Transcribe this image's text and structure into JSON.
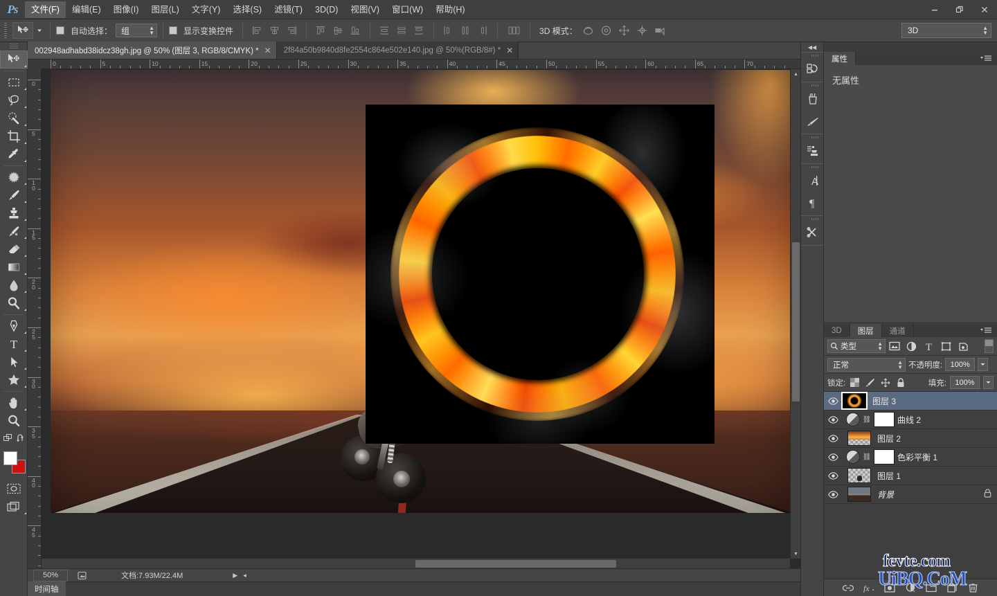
{
  "app": {
    "logo": "Ps",
    "theme_bg": "#3c3c3c",
    "accent": "#5a6a80"
  },
  "menubar": {
    "items": [
      {
        "label": "文件(F)",
        "active": true
      },
      {
        "label": "编辑(E)",
        "active": false
      },
      {
        "label": "图像(I)",
        "active": false
      },
      {
        "label": "图层(L)",
        "active": false
      },
      {
        "label": "文字(Y)",
        "active": false
      },
      {
        "label": "选择(S)",
        "active": false
      },
      {
        "label": "滤镜(T)",
        "active": false
      },
      {
        "label": "3D(D)",
        "active": false
      },
      {
        "label": "视图(V)",
        "active": false
      },
      {
        "label": "窗口(W)",
        "active": false
      },
      {
        "label": "帮助(H)",
        "active": false
      }
    ],
    "window_controls": {
      "minimize": "—",
      "restore": "❐",
      "close": "✕"
    }
  },
  "options_bar": {
    "tool_icon": "move-tool-icon",
    "auto_select_label": "自动选择：",
    "auto_select_value": "组",
    "auto_select_checked": false,
    "show_transform_label": "显示变换控件",
    "show_transform_checked": false,
    "mode_3d_label": "3D 模式：",
    "workspace": "3D"
  },
  "toolbox": {
    "tools": [
      {
        "name": "move-tool",
        "selected": true
      },
      {
        "name": "rectangular-marquee-tool",
        "selected": false
      },
      {
        "name": "lasso-tool",
        "selected": false
      },
      {
        "name": "quick-selection-tool",
        "selected": false
      },
      {
        "name": "crop-tool",
        "selected": false
      },
      {
        "name": "eyedropper-tool",
        "selected": false
      },
      {
        "name": "spot-healing-brush-tool",
        "selected": false
      },
      {
        "name": "brush-tool",
        "selected": false
      },
      {
        "name": "clone-stamp-tool",
        "selected": false
      },
      {
        "name": "history-brush-tool",
        "selected": false
      },
      {
        "name": "eraser-tool",
        "selected": false
      },
      {
        "name": "gradient-tool",
        "selected": false
      },
      {
        "name": "blur-tool",
        "selected": false
      },
      {
        "name": "dodge-tool",
        "selected": false
      },
      {
        "name": "pen-tool",
        "selected": false
      },
      {
        "name": "horizontal-type-tool",
        "selected": false
      },
      {
        "name": "path-selection-tool",
        "selected": false
      },
      {
        "name": "custom-shape-tool",
        "selected": false
      },
      {
        "name": "hand-tool",
        "selected": false
      },
      {
        "name": "zoom-tool",
        "selected": false
      }
    ],
    "foreground_color": "#ffffff",
    "background_color": "#cc1111"
  },
  "document_tabs": [
    {
      "label": "002948adhabd38idcz38gh.jpg @ 50% (图层 3, RGB/8/CMYK) *",
      "close": "✕",
      "active": true
    },
    {
      "label": "2f84a50b9840d8fe2554c864e502e140.jpg @ 50%(RGB/8#) *",
      "close": "✕",
      "active": false
    }
  ],
  "rulers": {
    "horizontal_ticks": [
      "0",
      "5",
      "10",
      "15",
      "20",
      "25",
      "30",
      "35",
      "40",
      "45",
      "50",
      "55",
      "60",
      "65",
      "70"
    ],
    "vertical_ticks": [
      "0",
      "5",
      "10",
      "15",
      "20",
      "25",
      "30",
      "35",
      "40",
      "45"
    ],
    "unit_step": 5
  },
  "canvas": {
    "artwork_description": "sunset sky over desert road with motorcycle, fire ring image placed on top",
    "placed_image": "fire-ring-on-black"
  },
  "status_bar": {
    "zoom": "50%",
    "doc_label": "文档:7.93M/22.4M",
    "play_arrow": "▶",
    "left_arrow": "◂"
  },
  "timeline": {
    "tab_label": "时间轴"
  },
  "right_dock": {
    "collapse": "◀◀",
    "icons": [
      {
        "name": "history-panel-icon"
      },
      {
        "name": "brush-presets-icon"
      },
      {
        "name": "brush-panel-icon"
      },
      {
        "name": "clone-source-icon"
      },
      {
        "name": "character-panel-icon"
      },
      {
        "name": "paragraph-panel-icon"
      },
      {
        "name": "tool-presets-icon"
      }
    ]
  },
  "properties_panel": {
    "tabs": [
      {
        "label": "属性",
        "active": true
      }
    ],
    "menu_icon": "panel-menu-icon",
    "empty_text": "无属性"
  },
  "layers_panel": {
    "tabs": [
      {
        "label": "3D",
        "active": false
      },
      {
        "label": "图层",
        "active": true
      },
      {
        "label": "通道",
        "active": false
      }
    ],
    "menu_icon": "panel-menu-icon",
    "filter": {
      "icon": "search-icon",
      "value": "类型",
      "type_icons": [
        "pixel-filter-icon",
        "adjustment-filter-icon",
        "type-filter-icon",
        "shape-filter-icon",
        "smart-object-filter-icon"
      ],
      "toggle": "filter-toggle-icon"
    },
    "blend_mode": "正常",
    "opacity_label": "不透明度:",
    "opacity_value": "100%",
    "lock_label": "锁定:",
    "lock_icons": [
      "lock-transparent-icon",
      "lock-image-icon",
      "lock-position-icon",
      "lock-all-icon"
    ],
    "fill_label": "填充:",
    "fill_value": "100%",
    "rows": [
      {
        "name": "图层 3",
        "visible": true,
        "selected": true,
        "kind": "pixel",
        "thumb": "fire-ring",
        "locked": false,
        "has_mask": false
      },
      {
        "name": "曲线 2",
        "visible": true,
        "selected": false,
        "kind": "adjustment",
        "thumb": "curves",
        "locked": false,
        "has_mask": true
      },
      {
        "name": "图层 2",
        "visible": true,
        "selected": false,
        "kind": "pixel",
        "thumb": "fire-clouds",
        "locked": false,
        "has_mask": false
      },
      {
        "name": "色彩平衡 1",
        "visible": true,
        "selected": false,
        "kind": "adjustment",
        "thumb": "color-balance",
        "locked": false,
        "has_mask": true
      },
      {
        "name": "图层 1",
        "visible": true,
        "selected": false,
        "kind": "pixel",
        "thumb": "motorcycle",
        "locked": false,
        "has_mask": false
      },
      {
        "name": "背景",
        "visible": true,
        "selected": false,
        "kind": "background",
        "thumb": "road-sky",
        "locked": true,
        "has_mask": false
      }
    ],
    "bottom_icons": [
      {
        "name": "link-layers-icon",
        "glyph": "⛓"
      },
      {
        "name": "layer-style-icon",
        "glyph": "fx"
      },
      {
        "name": "add-layer-mask-icon",
        "glyph": "▣"
      },
      {
        "name": "new-adjustment-layer-icon",
        "glyph": "◐"
      },
      {
        "name": "new-group-icon",
        "glyph": "▭"
      },
      {
        "name": "new-layer-icon",
        "glyph": "❐"
      },
      {
        "name": "delete-layer-icon",
        "glyph": "🗑"
      }
    ]
  },
  "watermarks": {
    "line1": "fevte.com",
    "line2": "UiBQ.CoM"
  }
}
